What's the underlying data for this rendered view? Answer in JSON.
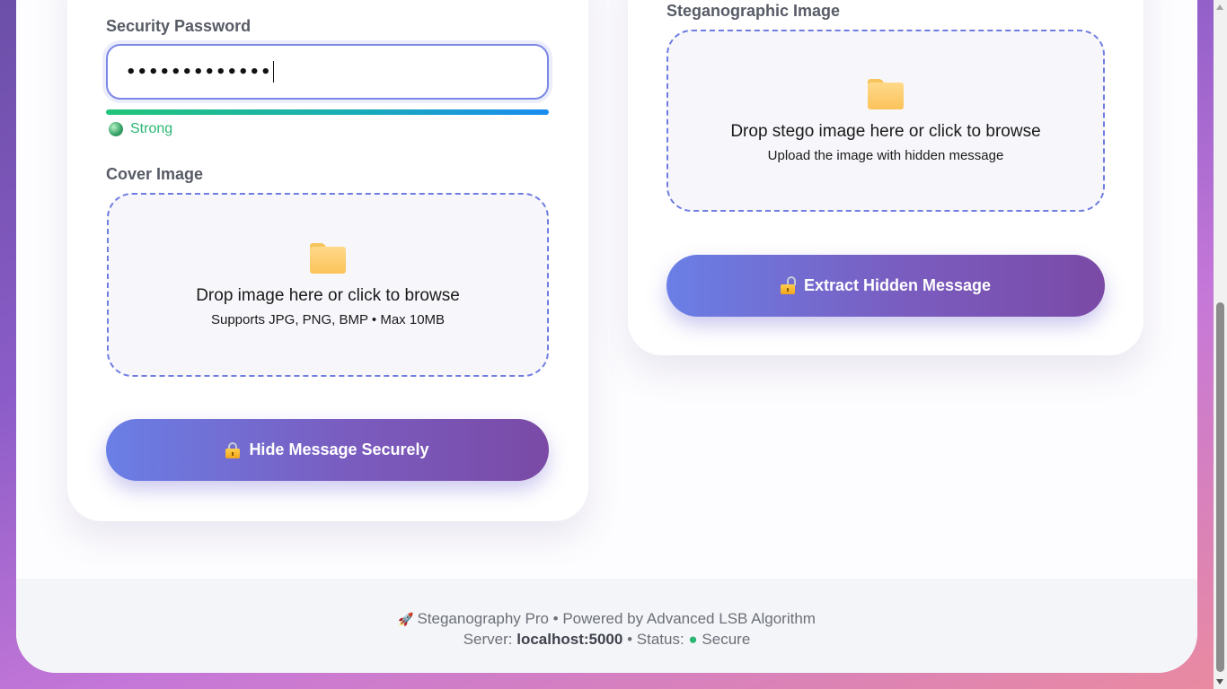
{
  "hide_panel": {
    "password_label": "Security Password",
    "password_value": "•••••••••••••",
    "strength": {
      "label": "Strong",
      "level": 1.0
    },
    "cover_label": "Cover Image",
    "dropzone_title": "Drop image here or click to browse",
    "dropzone_sub": "Supports JPG, PNG, BMP • Max 10MB",
    "button_label": "Hide Message Securely",
    "button_icon": "lock-icon"
  },
  "extract_panel": {
    "stego_label": "Steganographic Image",
    "dropzone_title": "Drop stego image here or click to browse",
    "dropzone_sub": "Upload the image with hidden message",
    "button_label": "Extract Hidden Message",
    "button_icon": "unlock-icon"
  },
  "footer": {
    "line1": "Steganography Pro • Powered by Advanced LSB Algorithm",
    "server_prefix": "Server:",
    "server": "localhost:5000",
    "status_prefix": "• Status:",
    "status_dot": "●",
    "status": "Secure",
    "icon": "rocket-icon"
  },
  "colors": {
    "accent": "#6f7de0",
    "button_gradient_start": "#6a7fe6",
    "button_gradient_end": "#7a4aa6",
    "strength_green": "#2bb673"
  }
}
